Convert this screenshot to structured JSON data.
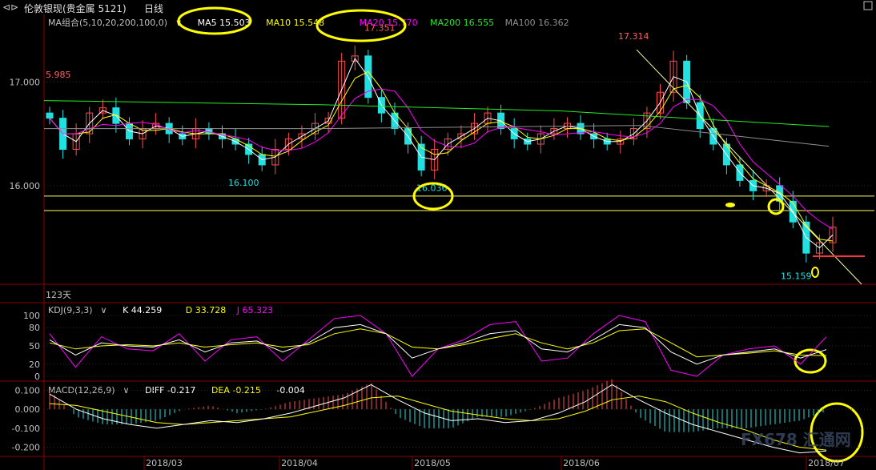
{
  "window": {
    "title": "伦敦银现(贵金属 5121)",
    "period": "日线",
    "instrument_icon": "chart-scroll-icon",
    "max_icon": "maximize-icon"
  },
  "colors": {
    "up": "#ff4d4d",
    "down": "#22e0e0",
    "ma5": "#ffffff",
    "ma10": "#ffff00",
    "ma20": "#ff00ff",
    "ma200": "#22ee22",
    "ma100": "#909090",
    "annotation": "#ffff00",
    "grid": "#8a0000",
    "label": "#c0c0c0",
    "price_hi": "#ff6060"
  },
  "main": {
    "ma_group": "MA组合(5,10,20,200,100,0)",
    "ma_entries": [
      {
        "label": "MA5 15.503",
        "color": "#ffffff"
      },
      {
        "label": "MA10 15.548",
        "color": "#ffff00"
      },
      {
        "label": "MA20 15.770",
        "color": "#ff00ff"
      },
      {
        "label": "MA200 16.555",
        "color": "#22ee22"
      },
      {
        "label": "MA100 16.362",
        "color": "#909090"
      }
    ],
    "y_ticks": [
      "17.000",
      "16.000"
    ],
    "y_range": [
      15.05,
      17.65
    ],
    "high_labels": [
      "17.351",
      "17.314",
      "5.985"
    ],
    "low_labels": [
      "16.100",
      "16.036",
      "15.159"
    ],
    "bars_label": "123天"
  },
  "kdj": {
    "title": "KDJ(9,3,3)",
    "entries": [
      {
        "label": "K 44.259",
        "color": "#ffffff"
      },
      {
        "label": "D 33.728",
        "color": "#ffff00"
      },
      {
        "label": "J 65.323",
        "color": "#ff00ff"
      }
    ],
    "y_ticks": [
      "100",
      "80",
      "50",
      "20",
      "0"
    ]
  },
  "macd": {
    "title": "MACD(12,26,9)",
    "entries": [
      {
        "label": "DIFF -0.217",
        "color": "#ffffff"
      },
      {
        "label": "DEA -0.215",
        "color": "#ffff00"
      },
      {
        "label": "-0.004",
        "color": "#ffffff"
      }
    ],
    "y_ticks": [
      "0.100",
      "0.000",
      "-0.100",
      "-0.200"
    ]
  },
  "x_axis": {
    "labels": [
      "2018/03",
      "2018/04",
      "2018/05",
      "2018/06",
      "2018/07"
    ]
  },
  "watermark": "FX678 汇通网",
  "chart_data": {
    "type": "candlestick",
    "title": "伦敦银现(贵金属 5121) 日线",
    "x_labels": [
      "2018/03",
      "2018/04",
      "2018/05",
      "2018/06",
      "2018/07"
    ],
    "ylim": [
      15.05,
      17.65
    ],
    "key_prices": {
      "highs": [
        17.351,
        17.314,
        16.985
      ],
      "lows": [
        16.1,
        16.036,
        15.159
      ]
    },
    "horizontal_lines": [
      15.9,
      15.76
    ],
    "close_path": [
      16.65,
      16.35,
      16.5,
      16.7,
      16.75,
      16.6,
      16.45,
      16.55,
      16.6,
      16.5,
      16.45,
      16.55,
      16.5,
      16.45,
      16.4,
      16.3,
      16.2,
      16.35,
      16.45,
      16.5,
      16.6,
      16.65,
      17.2,
      17.25,
      16.85,
      16.7,
      16.55,
      16.4,
      16.15,
      16.35,
      16.45,
      16.5,
      16.6,
      16.7,
      16.55,
      16.45,
      16.4,
      16.5,
      16.55,
      16.6,
      16.5,
      16.45,
      16.4,
      16.45,
      16.55,
      16.7,
      16.9,
      17.2,
      16.8,
      16.55,
      16.4,
      16.2,
      16.05,
      15.95,
      16.0,
      15.85,
      15.65,
      15.35,
      15.45,
      15.6
    ],
    "kdj": {
      "k": [
        60,
        35,
        55,
        50,
        48,
        60,
        40,
        55,
        58,
        40,
        55,
        80,
        85,
        70,
        30,
        45,
        55,
        70,
        75,
        45,
        40,
        60,
        85,
        80,
        40,
        20,
        35,
        40,
        45,
        30,
        44
      ],
      "d": [
        55,
        45,
        50,
        52,
        50,
        55,
        48,
        52,
        55,
        48,
        52,
        70,
        78,
        70,
        48,
        45,
        52,
        62,
        70,
        55,
        45,
        55,
        75,
        78,
        55,
        32,
        35,
        38,
        42,
        35,
        34
      ],
      "j": [
        70,
        15,
        65,
        45,
        42,
        70,
        25,
        60,
        65,
        25,
        60,
        95,
        100,
        70,
        0,
        45,
        60,
        85,
        90,
        25,
        30,
        70,
        100,
        90,
        10,
        0,
        35,
        45,
        50,
        20,
        65
      ]
    },
    "macd": {
      "diff": [
        0.08,
        0.0,
        -0.05,
        -0.08,
        -0.1,
        -0.08,
        -0.06,
        -0.07,
        -0.05,
        -0.02,
        0.02,
        0.06,
        0.13,
        0.05,
        -0.02,
        -0.06,
        -0.05,
        -0.07,
        -0.06,
        -0.02,
        0.04,
        0.13,
        0.05,
        -0.02,
        -0.08,
        -0.12,
        -0.16,
        -0.2,
        -0.23,
        -0.22
      ],
      "dea": [
        0.03,
        0.02,
        -0.01,
        -0.04,
        -0.07,
        -0.08,
        -0.07,
        -0.06,
        -0.05,
        -0.04,
        -0.01,
        0.02,
        0.06,
        0.07,
        0.03,
        -0.01,
        -0.03,
        -0.05,
        -0.06,
        -0.05,
        -0.01,
        0.05,
        0.07,
        0.04,
        -0.02,
        -0.07,
        -0.11,
        -0.16,
        -0.2,
        -0.215
      ],
      "ylim": [
        -0.24,
        0.14
      ]
    }
  }
}
